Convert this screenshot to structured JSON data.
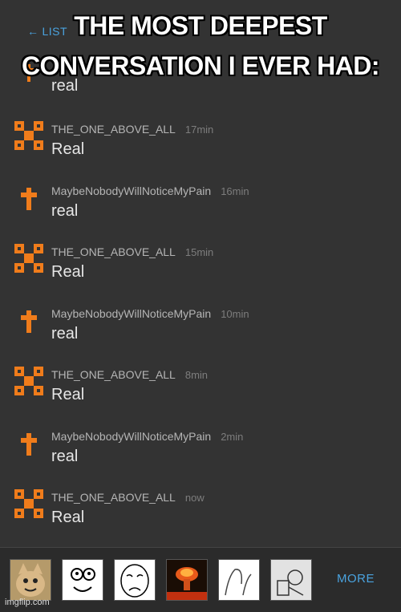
{
  "header": {
    "back_label": "LIST",
    "back_icon": "left-arrow-icon"
  },
  "caption": {
    "line1": "THE MOST DEEPEST",
    "line2": "CONVERSATION I EVER HAD:"
  },
  "first_message": {
    "text": "real"
  },
  "messages": [
    {
      "author": "THE_ONE_ABOVE_ALL",
      "time": "17min",
      "text": "Real",
      "avatar": "orange-block-logo-icon"
    },
    {
      "author": "MaybeNobodyWillNoticeMyPain",
      "time": "16min",
      "text": "real",
      "avatar": "orange-cross-icon"
    },
    {
      "author": "THE_ONE_ABOVE_ALL",
      "time": "15min",
      "text": "Real",
      "avatar": "orange-block-logo-icon"
    },
    {
      "author": "MaybeNobodyWillNoticeMyPain",
      "time": "10min",
      "text": "real",
      "avatar": "orange-cross-icon"
    },
    {
      "author": "THE_ONE_ABOVE_ALL",
      "time": "8min",
      "text": "Real",
      "avatar": "orange-block-logo-icon"
    },
    {
      "author": "MaybeNobodyWillNoticeMyPain",
      "time": "2min",
      "text": "real",
      "avatar": "orange-cross-icon"
    },
    {
      "author": "THE_ONE_ABOVE_ALL",
      "time": "now",
      "text": "Real",
      "avatar": "orange-block-logo-icon"
    }
  ],
  "bottom_bar": {
    "more_label": "MORE",
    "thumbnails": [
      "cat-thumbnail",
      "rage-face-thumbnail",
      "sad-face-thumbnail",
      "explosion-thumbnail",
      "sketch-thumbnail",
      "crying-thumbnail"
    ]
  },
  "watermark": "imgflip.com",
  "colors": {
    "accent": "#4aa3df",
    "orange": "#f07c1b",
    "background": "#333333"
  }
}
